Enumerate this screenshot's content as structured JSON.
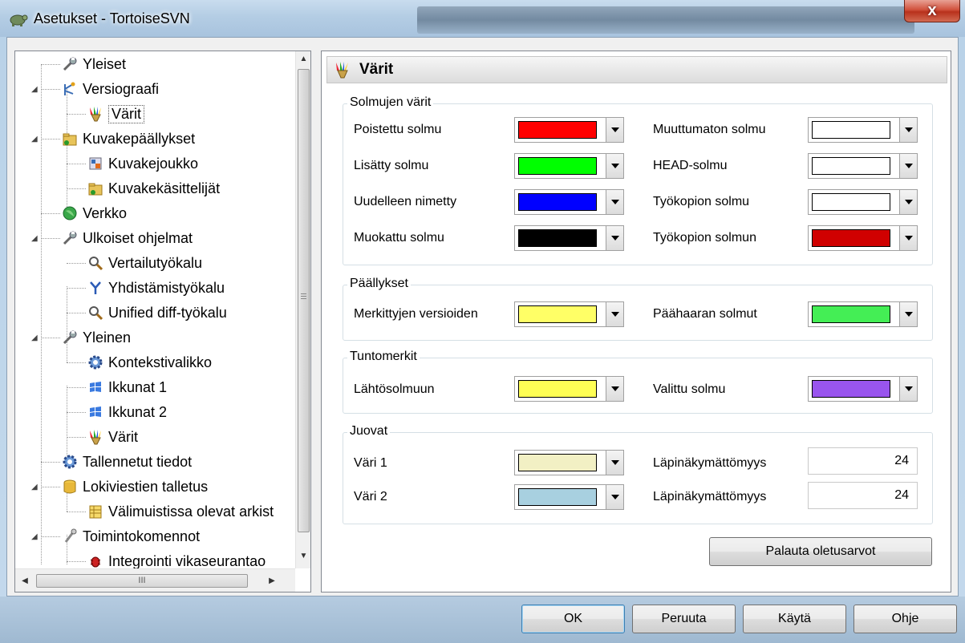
{
  "window": {
    "title": "Asetukset - TortoiseSVN",
    "close_label": "x"
  },
  "tree": {
    "items": [
      {
        "label": "Yleiset",
        "icon": "wrench-icon"
      },
      {
        "label": "Versiograafi",
        "icon": "revision-graph-icon"
      },
      {
        "label": "Värit",
        "icon": "colors-icon"
      },
      {
        "label": "Kuvakepäällykset",
        "icon": "overlay-folder-icon"
      },
      {
        "label": "Kuvakejoukko",
        "icon": "icon-set-icon"
      },
      {
        "label": "Kuvakekäsittelijät",
        "icon": "overlay-handler-icon"
      },
      {
        "label": "Verkko",
        "icon": "network-globe-icon"
      },
      {
        "label": "Ulkoiset ohjelmat",
        "icon": "wrench-icon"
      },
      {
        "label": "Vertailutyökalu",
        "icon": "magnifier-icon"
      },
      {
        "label": "Yhdistämistyökalu",
        "icon": "merge-icon"
      },
      {
        "label": "Unified diff-työkalu",
        "icon": "magnifier-icon"
      },
      {
        "label": "Yleinen",
        "icon": "wrench-icon"
      },
      {
        "label": "Kontekstivalikko",
        "icon": "gear-icon"
      },
      {
        "label": "Ikkunat 1",
        "icon": "windows-flag-icon"
      },
      {
        "label": "Ikkunat 2",
        "icon": "windows-flag-icon"
      },
      {
        "label": "Värit",
        "icon": "colors-icon"
      },
      {
        "label": "Tallennetut tiedot",
        "icon": "gear-icon"
      },
      {
        "label": "Lokiviestien talletus",
        "icon": "database-icon"
      },
      {
        "label": "Välimuistissa olevat arkist",
        "icon": "cache-table-icon"
      },
      {
        "label": "Toimintokomennot",
        "icon": "hook-scripts-icon"
      },
      {
        "label": "Integrointi vikaseurantao",
        "icon": "bug-icon"
      }
    ],
    "selected_index": 2
  },
  "panel": {
    "title": "Värit",
    "groups": {
      "nodes": {
        "title": "Solmujen värit",
        "left": [
          {
            "label": "Poistettu solmu",
            "color": "#ff0000"
          },
          {
            "label": "Lisätty solmu",
            "color": "#00ff00"
          },
          {
            "label": "Uudelleen nimetty",
            "color": "#0000ff"
          },
          {
            "label": "Muokattu solmu",
            "color": "#000000"
          }
        ],
        "right": [
          {
            "label": "Muuttumaton solmu",
            "color": "#ffffff"
          },
          {
            "label": "HEAD-solmu",
            "color": "#ffffff"
          },
          {
            "label": "Työkopion solmu",
            "color": "#ffffff"
          },
          {
            "label": "Työkopion solmun",
            "color": "#d00000"
          }
        ]
      },
      "overlays": {
        "title": "Päällykset",
        "left": {
          "label": "Merkittyjen versioiden",
          "color": "#ffff66"
        },
        "right": {
          "label": "Päähaaran solmut",
          "color": "#44ee55"
        }
      },
      "markers": {
        "title": "Tuntomerkit",
        "left": {
          "label": "Lähtösolmuun",
          "color": "#ffff55"
        },
        "right": {
          "label": "Valittu solmu",
          "color": "#9955ee"
        }
      },
      "stripes": {
        "title": "Juovat",
        "rows": [
          {
            "label": "Väri 1",
            "color": "#f2f0c4",
            "opacity_label": "Läpinäkymättömyys",
            "opacity": "24"
          },
          {
            "label": "Väri 2",
            "color": "#a8d0e0",
            "opacity_label": "Läpinäkymättömyys",
            "opacity": "24"
          }
        ]
      }
    },
    "reset_button": "Palauta oletusarvot"
  },
  "buttons": {
    "ok": "OK",
    "cancel": "Peruuta",
    "apply": "Käytä",
    "help": "Ohje"
  }
}
